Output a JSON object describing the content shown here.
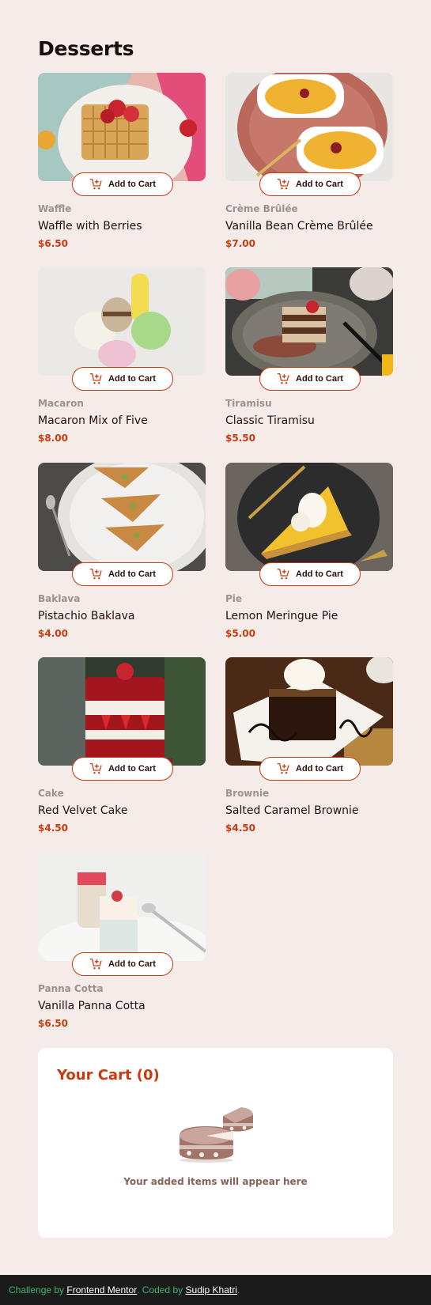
{
  "page": {
    "title": "Desserts"
  },
  "button_label": "Add to Cart",
  "products": [
    {
      "category": "Waffle",
      "name": "Waffle with Berries",
      "price": "$6.50",
      "image": "waffle"
    },
    {
      "category": "Crème Brûlée",
      "name": "Vanilla Bean Crème Brûlée",
      "price": "$7.00",
      "image": "creme-brulee"
    },
    {
      "category": "Macaron",
      "name": "Macaron Mix of Five",
      "price": "$8.00",
      "image": "macaron"
    },
    {
      "category": "Tiramisu",
      "name": "Classic Tiramisu",
      "price": "$5.50",
      "image": "tiramisu"
    },
    {
      "category": "Baklava",
      "name": "Pistachio Baklava",
      "price": "$4.00",
      "image": "baklava"
    },
    {
      "category": "Pie",
      "name": "Lemon Meringue Pie",
      "price": "$5.00",
      "image": "pie"
    },
    {
      "category": "Cake",
      "name": "Red Velvet Cake",
      "price": "$4.50",
      "image": "cake"
    },
    {
      "category": "Brownie",
      "name": "Salted Caramel Brownie",
      "price": "$4.50",
      "image": "brownie"
    },
    {
      "category": "Panna Cotta",
      "name": "Vanilla Panna Cotta",
      "price": "$6.50",
      "image": "panna-cotta"
    }
  ],
  "cart": {
    "title": "Your Cart (0)",
    "empty_message": "Your added items will appear here"
  },
  "footer": {
    "prefix": "Challenge by ",
    "link1": "Frontend Mentor",
    "middle": ". Coded by ",
    "link2": "Sudip Khatri",
    "suffix": "."
  },
  "colors": {
    "accent": "#c73b0f",
    "background": "#f5ecea",
    "text": "#260f08",
    "muted": "#a18f8a"
  },
  "icons": {
    "button": "cart-plus-icon",
    "empty_cart": "empty-cake-illustration"
  }
}
